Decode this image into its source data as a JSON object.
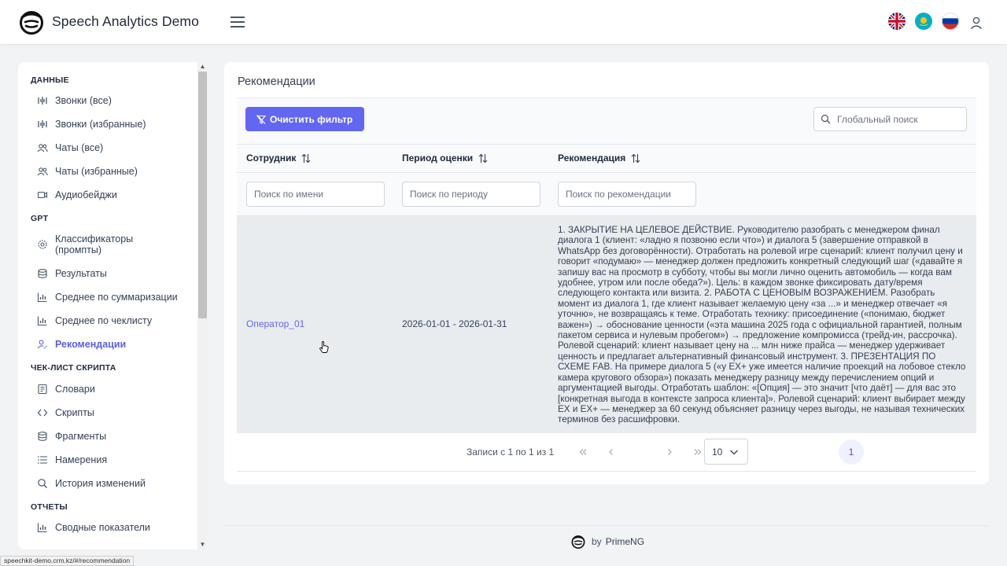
{
  "app": {
    "title": "Speech Analytics Demo"
  },
  "topbar": {
    "languages": [
      {
        "code": "en",
        "icon": "uk-flag-icon"
      },
      {
        "code": "kk",
        "icon": "kz-flag-icon"
      },
      {
        "code": "ru",
        "icon": "ru-flag-icon"
      }
    ],
    "user_icon": "user-icon"
  },
  "sidebar": {
    "sections": [
      {
        "title": "ДАННЫЕ",
        "items": [
          {
            "label": "Звонки (все)",
            "icon": "audio-wave-icon"
          },
          {
            "label": "Звонки (избранные)",
            "icon": "audio-wave-icon"
          },
          {
            "label": "Чаты (все)",
            "icon": "users-icon"
          },
          {
            "label": "Чаты (избранные)",
            "icon": "users-icon"
          },
          {
            "label": "Аудиобейджи",
            "icon": "video-icon"
          }
        ]
      },
      {
        "title": "GPT",
        "items": [
          {
            "label": "Классификаторы (промпты)",
            "icon": "gear-icon"
          },
          {
            "label": "Результаты",
            "icon": "database-icon"
          },
          {
            "label": "Среднее по суммаризации",
            "icon": "chart-bar-icon"
          },
          {
            "label": "Среднее по чеклисту",
            "icon": "chart-bar-icon"
          },
          {
            "label": "Рекомендации",
            "icon": "user-edit-icon",
            "active": true
          }
        ]
      },
      {
        "title": "ЧЕК-ЛИСТ СКРИПТА",
        "items": [
          {
            "label": "Словари",
            "icon": "book-icon"
          },
          {
            "label": "Скрипты",
            "icon": "code-icon"
          },
          {
            "label": "Фрагменты",
            "icon": "database-icon"
          },
          {
            "label": "Намерения",
            "icon": "list-icon"
          },
          {
            "label": "История изменений",
            "icon": "search-icon"
          }
        ]
      },
      {
        "title": "ОТЧЕТЫ",
        "items": [
          {
            "label": "Сводные показатели",
            "icon": "chart-bar-icon"
          }
        ]
      }
    ]
  },
  "main": {
    "title": "Рекомендации",
    "clear_filter_label": "Очистить фильтр",
    "global_search_placeholder": "Глобальный поиск",
    "columns": [
      {
        "label": "Сотрудник",
        "filter_placeholder": "Поиск по имени"
      },
      {
        "label": "Период оценки",
        "filter_placeholder": "Поиск по периоду"
      },
      {
        "label": "Рекомендация",
        "filter_placeholder": "Поиск по рекомендации"
      }
    ],
    "rows": [
      {
        "employee": "Оператор_01",
        "period": "2026-01-01 - 2026-01-31",
        "recommendation": "1. ЗАКРЫТИЕ НА ЦЕЛЕВОЕ ДЕЙСТВИЕ. Руководителю разобрать с менеджером финал диалога 1 (клиент: «ладно я позвоню если что») и диалога 5 (завершение отправкой в WhatsApp без договорённости). Отработать на ролевой игре сценарий: клиент получил цену и говорит «подумаю» — менеджер должен предложить конкретный следующий шаг («давайте я запишу вас на просмотр в субботу, чтобы вы могли лично оценить автомобиль — когда вам удобнее, утром или после обеда?»). Цель: в каждом звонке фиксировать дату/время следующего контакта или визита. 2. РАБОТА С ЦЕНОВЫМ ВОЗРАЖЕНИЕМ. Разобрать момент из диалога 1, где клиент называет желаемую цену «за ...» и менеджер отвечает «я уточню», не возвращаясь к теме. Отработать технику: присоединение («понимаю, бюджет важен») → обоснование ценности («эта машина 2025 года с официальной гарантией, полным пакетом сервиса и нулевым пробегом») → предложение компромисса (трейд-ин, рассрочка). Ролевой сценарий: клиент называет цену на ... млн ниже прайса — менеджер удерживает ценность и предлагает альтернативный финансовый инструмент. 3. ПРЕЗЕНТАЦИЯ ПО СХЕМЕ FAB. На примере диалога 5 («у EX+ уже имеется наличие проекций на лобовое стекло камера кругового обзора») показать менеджеру разницу между перечислением опций и аргументацией выгоды. Отработать шаблон: «[Опция] — это значит [что даёт] — для вас это [конкретная выгода в контексте запроса клиента]». Ролевой сценарий: клиент выбирает между EX и EX+ — менеджер за 60 секунд объясняет разницу через выгоды, не называя технических терминов без расшифровки."
      }
    ],
    "paginator": {
      "info": "Записи с 1 по 1 из 1",
      "current_page": "1",
      "rows_per_page": "10"
    }
  },
  "footer": {
    "by": "by",
    "brand": "PrimeNG"
  },
  "status_bar": {
    "url": "speechkit-demo.crm.kz/#/recommendation"
  },
  "colors": {
    "accent": "#6366f1",
    "active_nav": "#5b5fe6",
    "row_bg": "#e9ecef"
  }
}
